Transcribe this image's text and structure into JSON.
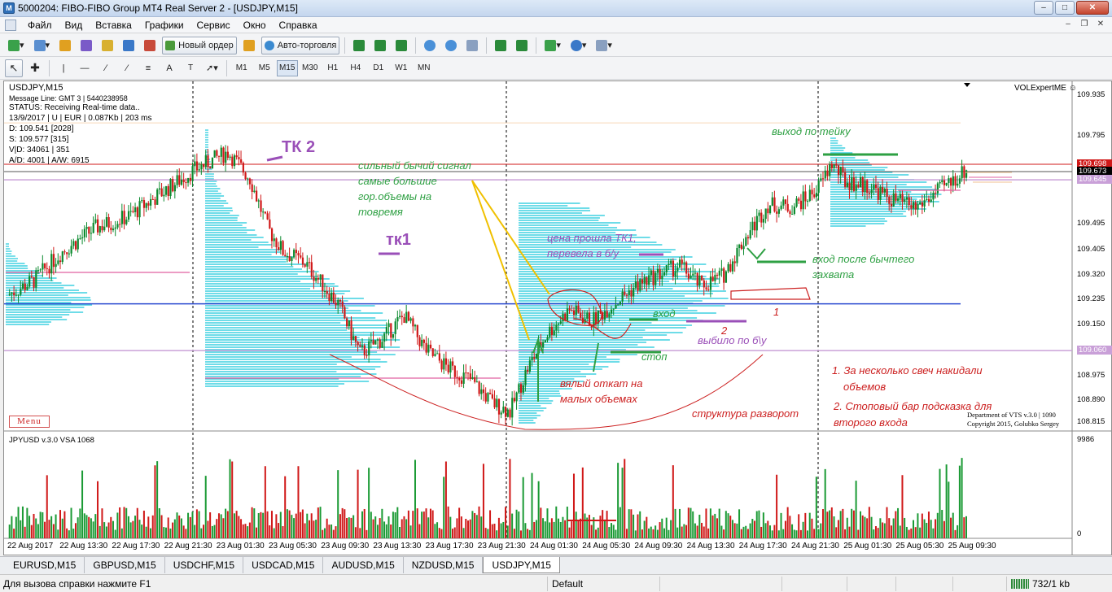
{
  "window": {
    "title": "5000204: FIBO-FIBO Group MT4 Real Server 2 - [USDJPY,M15]"
  },
  "menu": [
    "Файл",
    "Вид",
    "Вставка",
    "Графики",
    "Сервис",
    "Окно",
    "Справка"
  ],
  "toolbar": {
    "new_order": "Новый ордер",
    "auto_trading": "Авто-торговля"
  },
  "timeframes": [
    "M1",
    "M5",
    "M15",
    "M30",
    "H1",
    "H4",
    "D1",
    "W1",
    "MN"
  ],
  "active_timeframe": "M15",
  "chart": {
    "symbol_label": "USDJPY,M15",
    "indicator_name": "VOLExpertME",
    "info_lines": [
      "Message Line: GMT 3 | 5440238958",
      "STATUS:  Receiving Real-time data..",
      "13/9/2017 | U | EUR | 0.087Kb | 203 ms",
      "D: 109.541  [2028]",
      "S: 109.577  [315]",
      "V|D: 34061 | 351",
      "A/D: 4001 | A/W: 6915"
    ],
    "price_labels": [
      "109.935",
      "109.795",
      "109.655",
      "109.495",
      "109.405",
      "109.320",
      "109.235",
      "109.150",
      "109.060",
      "108.975",
      "108.890",
      "108.815"
    ],
    "price_tags": [
      {
        "value": "109.698",
        "color": "#d01818"
      },
      {
        "value": "109.673",
        "color": "#000000"
      },
      {
        "value": "109.645",
        "color": "#c9a0d8"
      },
      {
        "value": "109.060",
        "color": "#c9a0d8"
      }
    ],
    "x_labels": [
      "22 Aug 2017",
      "22 Aug 13:30",
      "22 Aug 17:30",
      "22 Aug 21:30",
      "23 Aug 01:30",
      "23 Aug 05:30",
      "23 Aug 09:30",
      "23 Aug 13:30",
      "23 Aug 17:30",
      "23 Aug 21:30",
      "24 Aug 01:30",
      "24 Aug 05:30",
      "24 Aug 09:30",
      "24 Aug 13:30",
      "24 Aug 17:30",
      "24 Aug 21:30",
      "25 Aug 01:30",
      "25 Aug 05:30",
      "25 Aug 09:30"
    ],
    "menu_button": "Menu",
    "copyright_lines": [
      "Department of VTS  v.3.0 | 1090",
      "Copyright 2015, Golubko Sergey"
    ],
    "sub_indicator": "JPYUSD v.3.0 VSA 1068",
    "sub_max": "9986",
    "sub_min": "0"
  },
  "annotations": {
    "tk2": "ТК 2",
    "tk1": "тк1",
    "bull_signal": [
      "сильный бычий сигнал",
      "самые большие",
      "гор.объемы на",
      "товремя"
    ],
    "exit_tick": "выход по тейку",
    "price_passed": [
      "цена прошла ТК1,",
      "перевела в б/у"
    ],
    "entry_after": [
      "вход после бычтего",
      "захвата"
    ],
    "entry": "вход",
    "stop": "стоп",
    "knocked": "выбило по б\\у",
    "weak_pullback": [
      "вялый откат на",
      "малых объемах"
    ],
    "num1": "1",
    "num2": "2",
    "note1": [
      "1. За несколько свеч накидали",
      "объемов"
    ],
    "note2": [
      "2. Стоповый бар подсказка для",
      "второго входа"
    ],
    "structure": "структура разворот"
  },
  "tabs": [
    "EURUSD,M15",
    "GBPUSD,M15",
    "USDCHF,M15",
    "USDCAD,M15",
    "AUDUSD,M15",
    "NZDUSD,M15",
    "USDJPY,M15"
  ],
  "active_tab": "USDJPY,M15",
  "status": {
    "help": "Для вызова справки нажмите F1",
    "profile": "Default",
    "traffic": "732/1 kb"
  },
  "colors": {
    "bull": "#0b8a2e",
    "bear": "#d01818",
    "profile": "#3fd1e0",
    "annotation_green": "#2ea043",
    "annotation_purple": "#9a4fb8",
    "annotation_red": "#cc2020"
  },
  "chart_data": {
    "type": "candlestick",
    "symbol": "USDJPY",
    "timeframe": "M15",
    "ylim": [
      108.79,
      109.96
    ],
    "close_path_points": [
      [
        0,
        109.25
      ],
      [
        12,
        109.3
      ],
      [
        25,
        109.4
      ],
      [
        40,
        109.48
      ],
      [
        55,
        109.52
      ],
      [
        70,
        109.6
      ],
      [
        85,
        109.68
      ],
      [
        95,
        109.72
      ],
      [
        100,
        109.74
      ],
      [
        110,
        109.65
      ],
      [
        118,
        109.48
      ],
      [
        125,
        109.4
      ],
      [
        135,
        109.36
      ],
      [
        150,
        109.22
      ],
      [
        160,
        109.05
      ],
      [
        170,
        109.1
      ],
      [
        180,
        109.18
      ],
      [
        190,
        109.06
      ],
      [
        200,
        109.0
      ],
      [
        210,
        108.96
      ],
      [
        220,
        108.88
      ],
      [
        228,
        108.85
      ],
      [
        236,
        109.0
      ],
      [
        245,
        109.12
      ],
      [
        255,
        109.2
      ],
      [
        265,
        109.16
      ],
      [
        275,
        109.22
      ],
      [
        285,
        109.28
      ],
      [
        295,
        109.32
      ],
      [
        305,
        109.35
      ],
      [
        315,
        109.28
      ],
      [
        325,
        109.32
      ],
      [
        335,
        109.45
      ],
      [
        345,
        109.56
      ],
      [
        355,
        109.55
      ],
      [
        362,
        109.58
      ],
      [
        368,
        109.62
      ],
      [
        374,
        109.7
      ],
      [
        380,
        109.64
      ],
      [
        392,
        109.62
      ],
      [
        400,
        109.58
      ],
      [
        412,
        109.55
      ],
      [
        425,
        109.62
      ],
      [
        435,
        109.68
      ]
    ]
  }
}
